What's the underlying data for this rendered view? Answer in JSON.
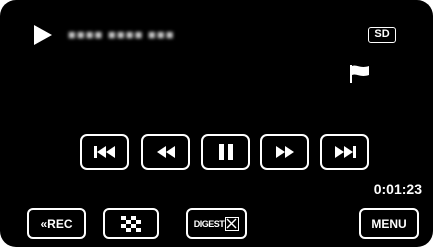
{
  "status": {
    "datetime": "■■■■ ■■■■ ■■■",
    "media_badge": "SD",
    "play_icon": "play-icon",
    "flag_icon": "flag-icon"
  },
  "controls": [
    {
      "name": "skip-back-button",
      "icon": "skip-back-icon"
    },
    {
      "name": "rewind-button",
      "icon": "rewind-icon"
    },
    {
      "name": "pause-button",
      "icon": "pause-icon"
    },
    {
      "name": "fast-forward-button",
      "icon": "fast-forward-icon"
    },
    {
      "name": "skip-forward-button",
      "icon": "skip-forward-icon"
    }
  ],
  "playback": {
    "elapsed_time": "0:01:23"
  },
  "bottom_bar": {
    "rec_chevron": "«",
    "rec_label": "REC",
    "index_icon": "index-grid-icon",
    "digest_label": "DIGEST",
    "menu_label": "MENU"
  }
}
